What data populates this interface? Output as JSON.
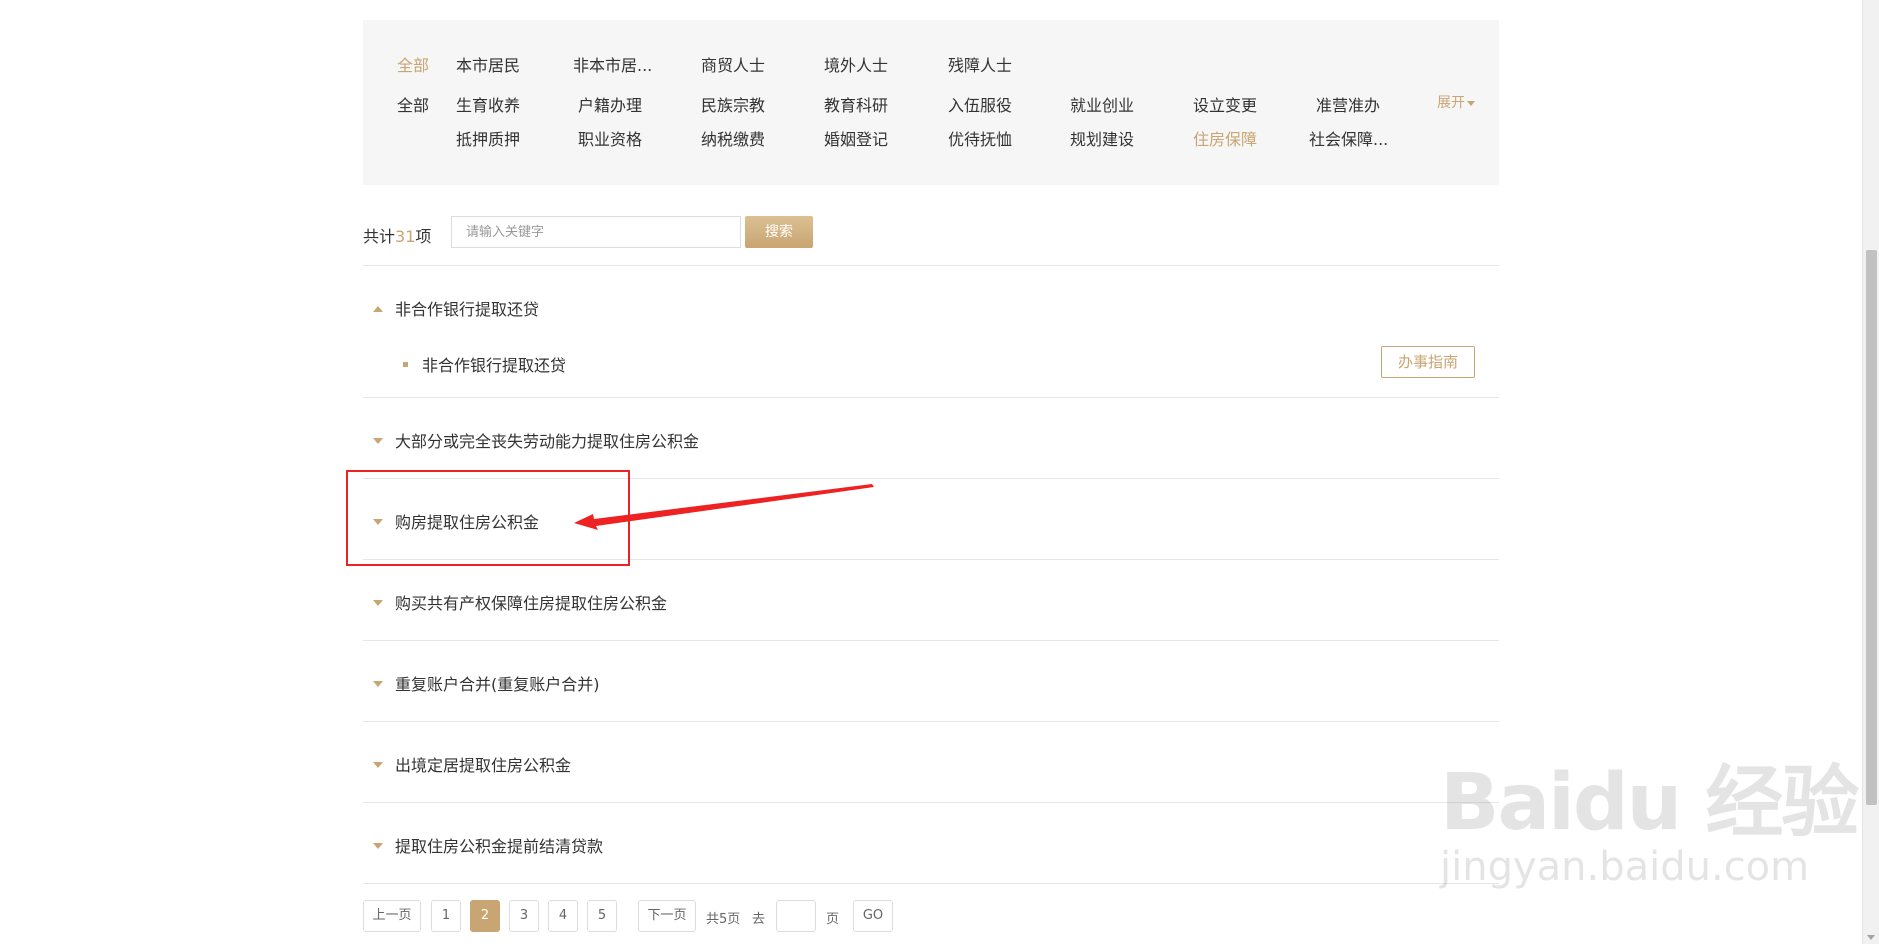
{
  "filters": {
    "row1_label": "全部",
    "row1_items": [
      "本市居民",
      "非本市居...",
      "商贸人士",
      "境外人士",
      "残障人士"
    ],
    "row2_label": "全部",
    "row2_items": [
      "生育收养",
      "户籍办理",
      "民族宗教",
      "教育科研",
      "入伍服役",
      "就业创业",
      "设立变更",
      "准营准办"
    ],
    "row3_items": [
      "抵押质押",
      "职业资格",
      "纳税缴费",
      "婚姻登记",
      "优待抚恤",
      "规划建设",
      "住房保障",
      "社会保障..."
    ],
    "expand_label": "展开"
  },
  "search": {
    "count_prefix": "共计",
    "count": "31",
    "count_suffix": "项",
    "placeholder": "请输入关键字",
    "button_label": "搜索"
  },
  "accordion": [
    {
      "title": "非合作银行提取还贷",
      "expanded": true,
      "sub_items": [
        {
          "label": "非合作银行提取还贷",
          "button": "办事指南"
        }
      ]
    },
    {
      "title": "大部分或完全丧失劳动能力提取住房公积金",
      "expanded": false
    },
    {
      "title": "购房提取住房公积金",
      "expanded": false
    },
    {
      "title": "购买共有产权保障住房提取住房公积金",
      "expanded": false
    },
    {
      "title": "重复账户合并(重复账户合并)",
      "expanded": false
    },
    {
      "title": "出境定居提取住房公积金",
      "expanded": false
    },
    {
      "title": "提取住房公积金提前结清贷款",
      "expanded": false
    }
  ],
  "pager": {
    "prev": "上一页",
    "pages": [
      "1",
      "2",
      "3",
      "4",
      "5"
    ],
    "current": "2",
    "next": "下一页",
    "total": "共5页",
    "goto_label": "去",
    "page_unit": "页",
    "go": "GO"
  },
  "watermark": {
    "main": "Baidu 经验",
    "sub": "jingyan.baidu.com"
  },
  "colors": {
    "accent": "#c8a572",
    "annotation": "#ee2222",
    "panel_bg": "#f6f6f6"
  }
}
